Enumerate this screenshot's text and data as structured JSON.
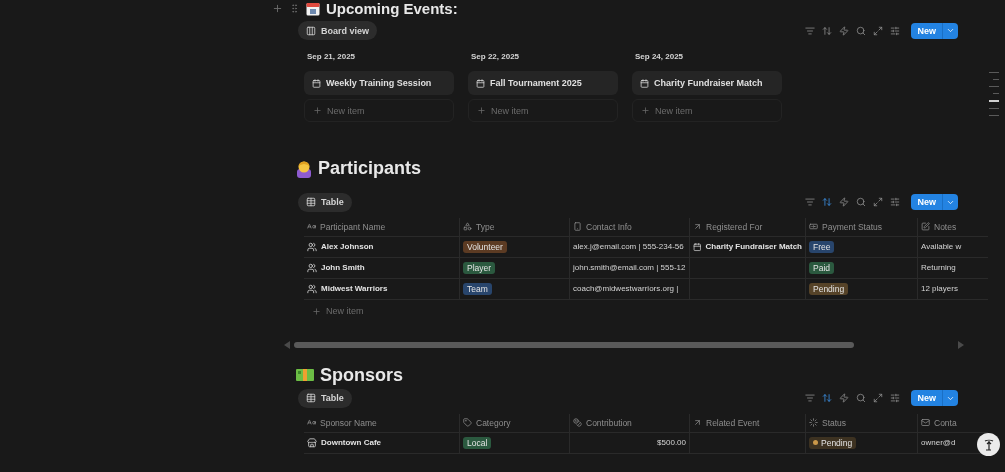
{
  "events": {
    "title": "Upcoming Events:",
    "view": "Board view",
    "toolbar": {
      "sort_active": false,
      "new": "New"
    },
    "columns": [
      {
        "date": "Sep 21, 2025",
        "cards": [
          "Weekly Training Session"
        ],
        "new_item": "New item"
      },
      {
        "date": "Sep 22, 2025",
        "cards": [
          "Fall Tournament 2025"
        ],
        "new_item": "New item"
      },
      {
        "date": "Sep 24, 2025",
        "cards": [
          "Charity Fundraiser Match"
        ],
        "new_item": "New item"
      }
    ]
  },
  "participants": {
    "title": "Participants",
    "view": "Table",
    "toolbar": {
      "sort_active": true,
      "new": "New"
    },
    "columns": [
      {
        "kind": "title",
        "label": "Participant Name"
      },
      {
        "kind": "select",
        "label": "Type"
      },
      {
        "kind": "phone",
        "label": "Contact Info"
      },
      {
        "kind": "relation",
        "label": "Registered For"
      },
      {
        "kind": "payment",
        "label": "Payment Status"
      },
      {
        "kind": "notes",
        "label": "Notes"
      }
    ],
    "rows": [
      {
        "cells": [
          {
            "kind": "title",
            "text": "Alex Johnson"
          },
          {
            "kind": "tag",
            "text": "Volunteer",
            "color": "#5c3b23"
          },
          {
            "kind": "text",
            "text": "alex.j@email.com | 555-234-56"
          },
          {
            "kind": "relation",
            "text": "Charity Fundraiser Match"
          },
          {
            "kind": "tag",
            "text": "Free",
            "color": "#28456c"
          },
          {
            "kind": "text",
            "text": "Available w"
          }
        ]
      },
      {
        "cells": [
          {
            "kind": "title",
            "text": "John Smith"
          },
          {
            "kind": "tag",
            "text": "Player",
            "color": "#2b593f"
          },
          {
            "kind": "text",
            "text": "john.smith@email.com | 555-12"
          },
          {
            "kind": "relation"
          },
          {
            "kind": "tag",
            "text": "Paid",
            "color": "#2b593f"
          },
          {
            "kind": "text",
            "text": "Returning"
          }
        ]
      },
      {
        "cells": [
          {
            "kind": "title",
            "text": "Midwest Warriors"
          },
          {
            "kind": "tag",
            "text": "Team",
            "color": "#28456c"
          },
          {
            "kind": "text",
            "text": "coach@midwestwarriors.org |"
          },
          {
            "kind": "relation"
          },
          {
            "kind": "tag",
            "text": "Pending",
            "color": "#564328"
          },
          {
            "kind": "text",
            "text": "12 players"
          }
        ]
      }
    ],
    "new_item": "New item"
  },
  "sponsors": {
    "title": "Sponsors",
    "view": "Table",
    "toolbar": {
      "sort_active": true,
      "new": "New"
    },
    "columns": [
      {
        "kind": "title",
        "label": "Sponsor Name"
      },
      {
        "kind": "tags",
        "label": "Category"
      },
      {
        "kind": "number",
        "label": "Contribution"
      },
      {
        "kind": "relation",
        "label": "Related Event"
      },
      {
        "kind": "status",
        "label": "Status"
      },
      {
        "kind": "email",
        "label": "Conta"
      }
    ],
    "rows": [
      {
        "cells": [
          {
            "kind": "title",
            "text": "Downtown Cafe"
          },
          {
            "kind": "tag",
            "text": "Local",
            "color": "#2b593f"
          },
          {
            "kind": "number",
            "text": "$500.00"
          },
          {
            "kind": "relation"
          },
          {
            "kind": "status",
            "text": "Pending",
            "color": "#ca9849"
          },
          {
            "kind": "text",
            "text": "owner@d"
          }
        ]
      }
    ]
  }
}
